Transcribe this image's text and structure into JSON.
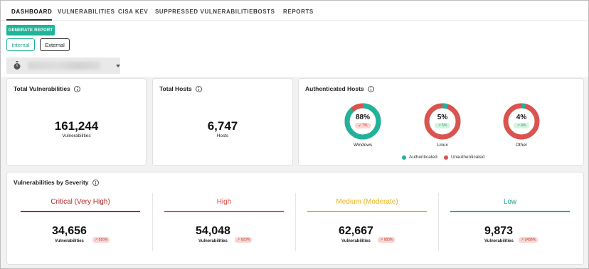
{
  "tabs": [
    {
      "label": "DASHBOARD"
    },
    {
      "label": "VULNERABILITIES"
    },
    {
      "label": "CISA KEV"
    },
    {
      "label": "SUPPRESSED VULNERABILITIES"
    },
    {
      "label": "HOSTS"
    },
    {
      "label": "REPORTS"
    }
  ],
  "toolbar": {
    "generate_label": "GENERATE REPORT",
    "segments": [
      "Internal",
      "External"
    ],
    "selected_segment": "Internal",
    "select_icon": "stopwatch-icon"
  },
  "total_vulnerabilities": {
    "title": "Total Vulnerabilities",
    "value": "161,244",
    "label": "Vulnerabilities"
  },
  "total_hosts": {
    "title": "Total Hosts",
    "value": "6,747",
    "label": "Hosts"
  },
  "authenticated_hosts": {
    "title": "Authenticated Hosts",
    "donuts": [
      {
        "name": "Windows",
        "pct_text": "88%",
        "pct": 88,
        "change": "↙ 7%",
        "trend": "down"
      },
      {
        "name": "Linux",
        "pct_text": "5%",
        "pct": 5,
        "change": "↗ 5%",
        "trend": "up"
      },
      {
        "name": "Other",
        "pct_text": "4%",
        "pct": 4,
        "change": "↗ 4%",
        "trend": "up"
      }
    ],
    "legend": [
      {
        "label": "Authenticated",
        "color": "#1fb39a"
      },
      {
        "label": "Unauthenticated",
        "color": "#d9534f"
      }
    ]
  },
  "severity": {
    "title": "Vulnerabilities by Severity",
    "levels": [
      {
        "title": "Critical (Very High)",
        "color": "#b32a2a",
        "value": "34,656",
        "label": "Vulnerabilities",
        "change": "↗ 816%"
      },
      {
        "title": "High",
        "color": "#d9534f",
        "value": "54,048",
        "label": "Vulnerabilities",
        "change": "↗ 623%"
      },
      {
        "title": "Medium (Moderate)",
        "color": "#e6b422",
        "value": "62,667",
        "label": "Vulnerabilities",
        "change": "↗ 683%"
      },
      {
        "title": "Low",
        "color": "#1fb39a",
        "value": "9,873",
        "label": "Vulnerabilities",
        "change": "↗ 2438%"
      }
    ]
  }
}
